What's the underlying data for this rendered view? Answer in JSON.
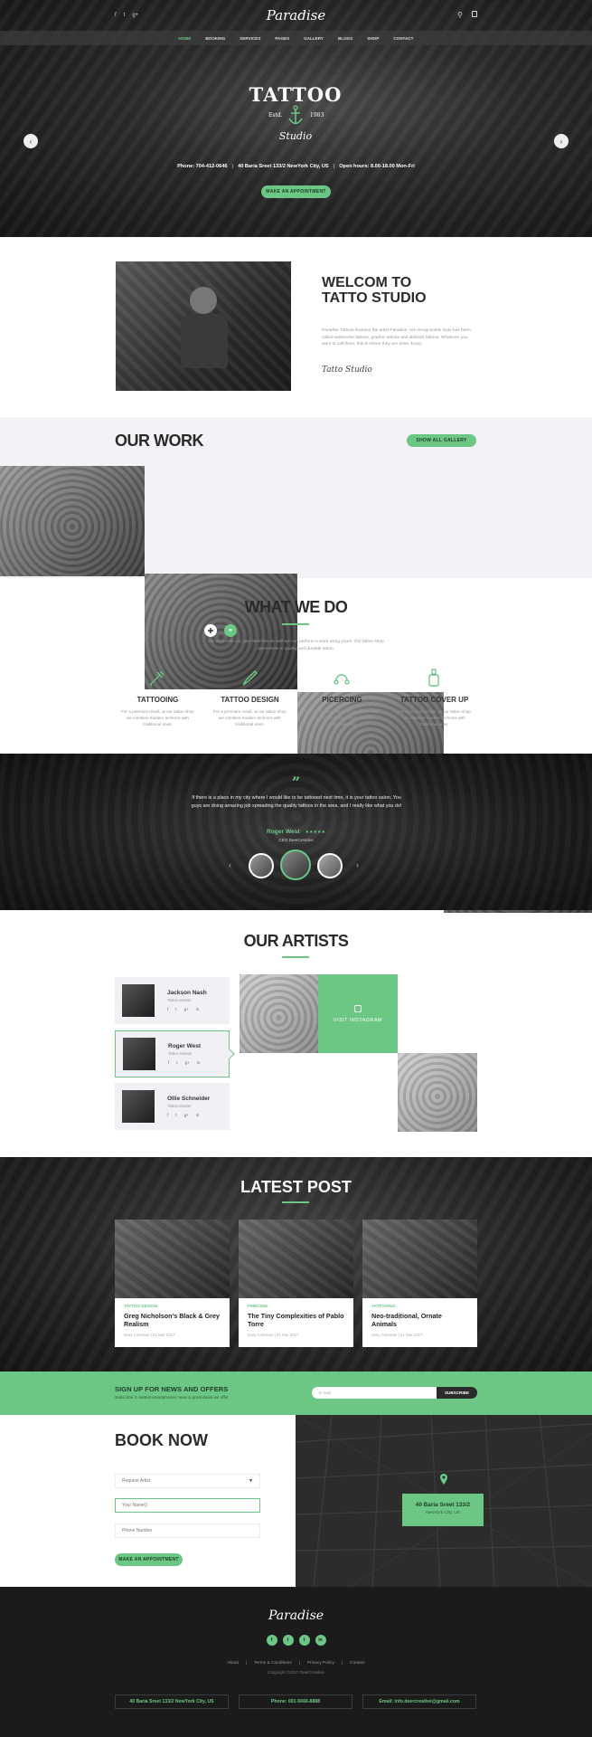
{
  "brand": {
    "logo_text": "Paradise"
  },
  "topbar": {
    "social": [
      "f",
      "t",
      "g+"
    ]
  },
  "nav": {
    "items": [
      "HOME",
      "BOOKING",
      "SERVICES",
      "PAGES",
      "GALLERY",
      "BLOGS",
      "SHOP",
      "CONTACT"
    ],
    "active_index": 0
  },
  "hero": {
    "badge_title": "TATTOO",
    "badge_estd": "Estd.",
    "badge_year": "1983",
    "badge_script": "Studio",
    "info_phone": "Phone: 704-412-0646",
    "info_address": "40 Baria Sreet 133/2 NewYork City, US",
    "info_hours": "Open hours: 8.00-18.00 Mon-Fri",
    "cta": "MAKE AN APPOINTMENT"
  },
  "welcome": {
    "title_line1": "WELCOM TO",
    "title_line2": "TATTO STUDIO",
    "text": "Paradise Tattoos features the artist Paradise. His recognizable style has been called watercolor tattoos, graphic tattoos and abstract tattoos. Whatever you want to call them, this is where they are done. Enjoy",
    "signature": "Tatto Studio"
  },
  "work": {
    "title": "OUR WORK",
    "button": "SHOW ALL GALLERY"
  },
  "services": {
    "title": "WHAT WE DO",
    "intro": "We work with our own sketches as well we can perform a work using yours. Our tattoo shop specializes in quality and durable tattoo.",
    "items": [
      {
        "title": "TATTOOING",
        "icon": "tattoo-machine-icon",
        "desc": "For a premium result, at our tattoo shop we combine modern technics with traditional ones."
      },
      {
        "title": "TATTOO DESIGN",
        "icon": "pen-design-icon",
        "desc": "For a premium result, at our tattoo shop we combine modern technics with traditional ones."
      },
      {
        "title": "PICERCING",
        "icon": "piercing-icon",
        "desc": "For a premium result, at our tattoo shop we combine modern technics with traditional ones."
      },
      {
        "title": "TATTOO COVER UP",
        "icon": "ink-bottle-icon",
        "desc": "For a premium result, at our tattoo shop we combine modern technics with traditional ones."
      }
    ]
  },
  "testimonial": {
    "quote_mark": "”",
    "text": "If there is a place in my city where I would like to be tattooed next time, it is your tattoo salon. You guys are doing amazing job spreading the quality tattoos in the area, and I really like what you do!",
    "author": "Roger West",
    "stars": "★★★★★",
    "role": "CEO DeerCreative"
  },
  "artists": {
    "title": "OUR ARTISTS",
    "list": [
      {
        "name": "Jackson Nash",
        "role": "Tattoo Master"
      },
      {
        "name": "Roger West",
        "role": "Tattoo Master"
      },
      {
        "name": "Ollie Schneider",
        "role": "Tattoo Master"
      }
    ],
    "social": [
      "f",
      "t",
      "g+",
      "in"
    ],
    "instagram": "VISIT INSTAGRAM"
  },
  "posts": {
    "title": "LATEST POST",
    "items": [
      {
        "category": "TATTOO DESIGN",
        "title": "Greg Nicholson's Black & Grey Realism",
        "meta": "Gary Coleman | 21 Mar 2017"
      },
      {
        "category": "PEIRCING",
        "title": "The Tiny Complexities of Pablo Torre",
        "meta": "Gary Coleman | 21 Mar 2017"
      },
      {
        "category": "TATTOOING",
        "title": "Neo-traditional, Ornate Animals",
        "meta": "Gary Coleman | 21 Mar 2017"
      }
    ]
  },
  "newsletter": {
    "title": "SIGN UP FOR NEWS AND OFFERS",
    "subtitle": "Subscribe to lastest smartphones news & great deals we offer",
    "placeholder": "E-mail",
    "button": "SUBSCRIBE"
  },
  "booking": {
    "title": "BOOK NOW",
    "select_artist": "Request Artist",
    "name_placeholder": "Your Name()",
    "phone_placeholder": "Phone Number",
    "button": "MAKE AN APPOINTMENT",
    "map_address": "40 Baria Sreet 133/2",
    "map_city": "NewYork City, US"
  },
  "footer": {
    "logo": "Paradise",
    "social": [
      "f",
      "t",
      "t",
      "in"
    ],
    "links": [
      "About",
      "Terms & Conditions",
      "Privacy Policy",
      "Contact"
    ],
    "copyright": "Copyright ©2017 DeerCreative",
    "address": "40 Baria Sreet 133/2 NewYork City, US",
    "phone": "Phone: 001-5666-8888",
    "email": "Email: info.deercreative@gmail.com"
  },
  "colors": {
    "accent": "#6cc785",
    "dark": "#1b1b1b",
    "light_bg": "#f3f3f7"
  }
}
